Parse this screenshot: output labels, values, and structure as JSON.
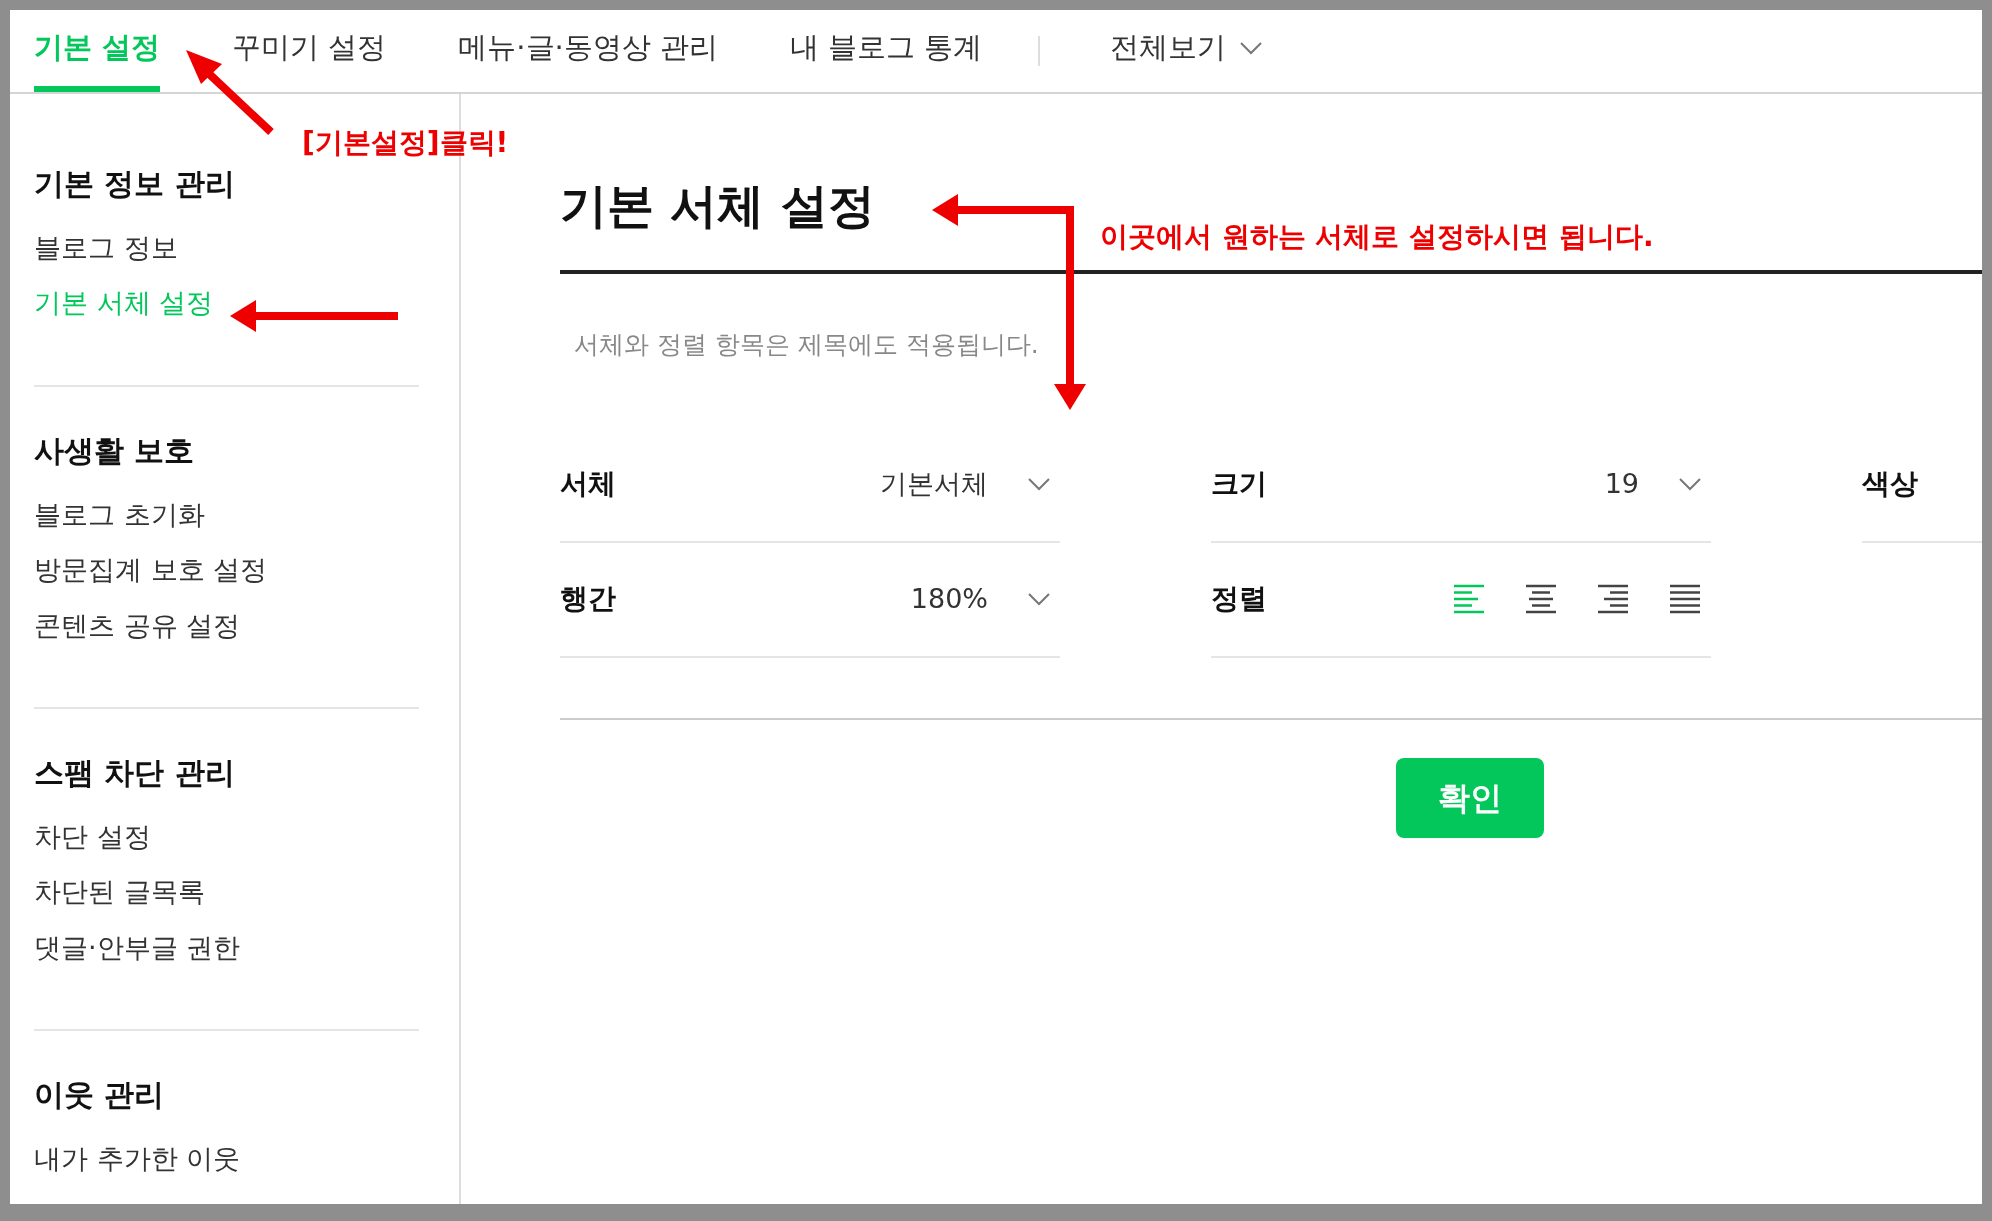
{
  "tabs": [
    {
      "label": "기본 설정",
      "selected": true,
      "kind": "tab"
    },
    {
      "label": "꾸미기 설정",
      "selected": false,
      "kind": "tab"
    },
    {
      "label": "메뉴·글·동영상 관리",
      "selected": false,
      "kind": "tab"
    },
    {
      "label": "내 블로그 통계",
      "selected": false,
      "kind": "tab"
    },
    {
      "label": "전체보기",
      "selected": false,
      "kind": "dropdown"
    }
  ],
  "sidebar": {
    "sections": [
      {
        "title": "기본 정보 관리",
        "items": [
          {
            "label": "블로그 정보",
            "selected": false
          },
          {
            "label": "기본 서체 설정",
            "selected": true
          }
        ]
      },
      {
        "title": "사생활 보호",
        "items": [
          {
            "label": "블로그 초기화",
            "selected": false
          },
          {
            "label": "방문집계 보호 설정",
            "selected": false
          },
          {
            "label": "콘텐츠 공유 설정",
            "selected": false
          }
        ]
      },
      {
        "title": "스팸 차단 관리",
        "items": [
          {
            "label": "차단 설정",
            "selected": false
          },
          {
            "label": "차단된 글목록",
            "selected": false
          },
          {
            "label": "댓글·안부글 권한",
            "selected": false
          }
        ]
      },
      {
        "title": "이웃 관리",
        "items": [
          {
            "label": "내가 추가한 이웃",
            "selected": false
          }
        ]
      }
    ]
  },
  "main": {
    "title": "기본 서체 설정",
    "note": "서체와 정렬 항목은 제목에도 적용됩니다.",
    "settings": [
      {
        "label": "서체",
        "kind": "select",
        "value": "기본서체"
      },
      {
        "label": "크기",
        "kind": "select",
        "value": "19"
      },
      {
        "label": "색상",
        "kind": "color"
      },
      {
        "label": "행간",
        "kind": "select",
        "value": "180%"
      },
      {
        "label": "정렬",
        "kind": "align",
        "options": [
          {
            "kind": "left",
            "selected": true
          },
          {
            "kind": "center",
            "selected": false
          },
          {
            "kind": "right",
            "selected": false
          },
          {
            "kind": "justify",
            "selected": false
          }
        ]
      }
    ],
    "confirm_button": "확인"
  },
  "annotations": [
    {
      "text": "[기본설정]클릭!"
    },
    {
      "text": "이곳에서 원하는 서체로 설정하시면 됩니다."
    }
  ]
}
